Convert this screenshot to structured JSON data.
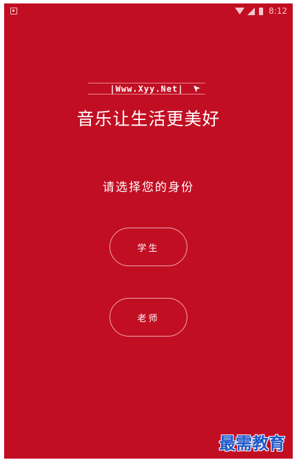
{
  "status_bar": {
    "time": "8:12",
    "icons": [
      "notification-icon",
      "wifi-icon",
      "signal-icon",
      "battery-icon"
    ]
  },
  "header": {
    "url_watermark": "|Www.Xyy.Net|",
    "slogan": "音乐让生活更美好"
  },
  "main": {
    "prompt": "请选择您的身份",
    "roles": [
      {
        "label": "学生"
      },
      {
        "label": "老师"
      }
    ]
  },
  "branding": {
    "logo_text": "最需教育"
  },
  "colors": {
    "background": "#c20e23",
    "button_border": "#f0a7af",
    "logo": "#1a56c8"
  }
}
